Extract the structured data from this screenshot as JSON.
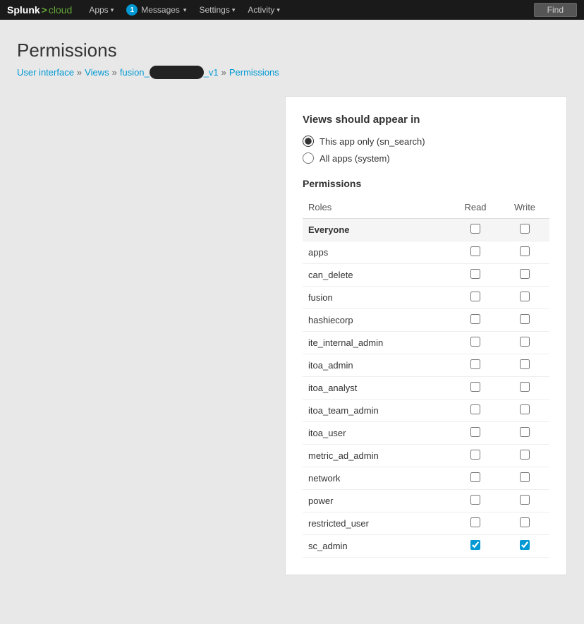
{
  "topnav": {
    "logo": "Splunk>cloud",
    "logo_splunk": "Splunk",
    "logo_arrow": ">",
    "logo_cloud": "cloud",
    "items": [
      {
        "label": "Apps",
        "caret": true
      },
      {
        "label": "Messages",
        "caret": true,
        "badge": "1"
      },
      {
        "label": "Settings",
        "caret": true
      },
      {
        "label": "Activity",
        "caret": true
      }
    ],
    "find_label": "Find"
  },
  "page": {
    "title": "Permissions",
    "breadcrumb": {
      "parts": [
        {
          "label": "User interface",
          "link": true
        },
        {
          "label": "Views",
          "link": true
        },
        {
          "label": "fusion_[redacted]_v1",
          "redacted": true,
          "link": true
        },
        {
          "label": "Permissions",
          "link": true
        }
      ]
    }
  },
  "card": {
    "views_section_label": "Views should appear in",
    "radio_options": [
      {
        "label": "This app only (sn_search)",
        "checked": true
      },
      {
        "label": "All apps (system)",
        "checked": false
      }
    ],
    "permissions_label": "Permissions",
    "table": {
      "columns": [
        "Roles",
        "Read",
        "Write"
      ],
      "rows": [
        {
          "role": "Everyone",
          "read": false,
          "write": false,
          "bold": true
        },
        {
          "role": "apps",
          "read": false,
          "write": false
        },
        {
          "role": "can_delete",
          "read": false,
          "write": false
        },
        {
          "role": "fusion",
          "read": false,
          "write": false
        },
        {
          "role": "hashiecorp",
          "read": false,
          "write": false
        },
        {
          "role": "ite_internal_admin",
          "read": false,
          "write": false
        },
        {
          "role": "itoa_admin",
          "read": false,
          "write": false
        },
        {
          "role": "itoa_analyst",
          "read": false,
          "write": false
        },
        {
          "role": "itoa_team_admin",
          "read": false,
          "write": false
        },
        {
          "role": "itoa_user",
          "read": false,
          "write": false
        },
        {
          "role": "metric_ad_admin",
          "read": false,
          "write": false
        },
        {
          "role": "network",
          "read": false,
          "write": false
        },
        {
          "role": "power",
          "read": false,
          "write": false
        },
        {
          "role": "restricted_user",
          "read": false,
          "write": false
        },
        {
          "role": "sc_admin",
          "read": true,
          "write": true
        }
      ]
    }
  }
}
